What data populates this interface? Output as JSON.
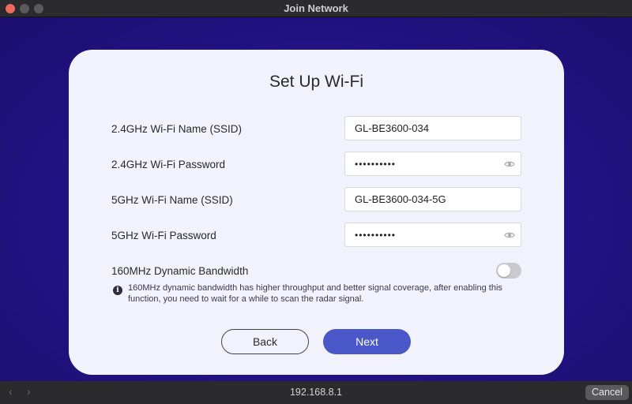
{
  "window": {
    "title": "Join Network"
  },
  "card": {
    "heading": "Set Up Wi-Fi",
    "fields": [
      {
        "label": "2.4GHz Wi-Fi Name (SSID)",
        "value": "GL-BE3600-034"
      },
      {
        "label": "2.4GHz Wi-Fi Password",
        "value": "••••••••••",
        "icon": "eye-icon"
      },
      {
        "label": "5GHz Wi-Fi Name (SSID)",
        "value": "GL-BE3600-034-5G"
      },
      {
        "label": "5GHz Wi-Fi Password",
        "value": "••••••••••",
        "icon": "eye-icon"
      }
    ],
    "bandwidth": {
      "label": "160MHz Dynamic Bandwidth",
      "enabled": false,
      "info_icon": "info-icon",
      "info_text": "160MHz dynamic bandwidth has higher throughput and better signal coverage, after enabling this function, you need to wait for a while to scan the radar signal."
    },
    "buttons": {
      "back": "Back",
      "next": "Next"
    }
  },
  "bottombar": {
    "url": "192.168.8.1",
    "cancel": "Cancel",
    "back_icon": "chevron-left-icon",
    "forward_icon": "chevron-right-icon"
  },
  "colors": {
    "background": "#24138a",
    "card": "#f1f2fb",
    "primary_button": "#4a57c9",
    "toggle_off": "#c9c9cf"
  }
}
